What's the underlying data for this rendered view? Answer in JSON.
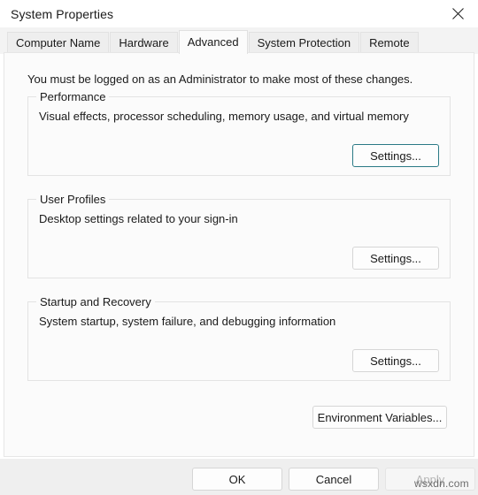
{
  "window": {
    "title": "System Properties",
    "close_icon": "close-icon"
  },
  "tabs": [
    {
      "label": "Computer Name",
      "active": false
    },
    {
      "label": "Hardware",
      "active": false
    },
    {
      "label": "Advanced",
      "active": true
    },
    {
      "label": "System Protection",
      "active": false
    },
    {
      "label": "Remote",
      "active": false
    }
  ],
  "panel": {
    "admin_note": "You must be logged on as an Administrator to make most of these changes.",
    "groups": [
      {
        "legend": "Performance",
        "description": "Visual effects, processor scheduling, memory usage, and virtual memory",
        "button_label": "Settings...",
        "button_focused": true
      },
      {
        "legend": "User Profiles",
        "description": "Desktop settings related to your sign-in",
        "button_label": "Settings...",
        "button_focused": false
      },
      {
        "legend": "Startup and Recovery",
        "description": "System startup, system failure, and debugging information",
        "button_label": "Settings...",
        "button_focused": false
      }
    ],
    "environment_variables_label": "Environment Variables..."
  },
  "footer": {
    "ok_label": "OK",
    "cancel_label": "Cancel",
    "apply_label": "Apply",
    "apply_disabled": true
  },
  "watermark": "wsxdn.com",
  "colors": {
    "focus_border": "#2b7a86",
    "panel_bg": "#fbfbfb",
    "footer_bg": "#efefef",
    "tab_active_bg": "#fbfbfb",
    "tab_inactive_bg": "#eeeeee"
  }
}
